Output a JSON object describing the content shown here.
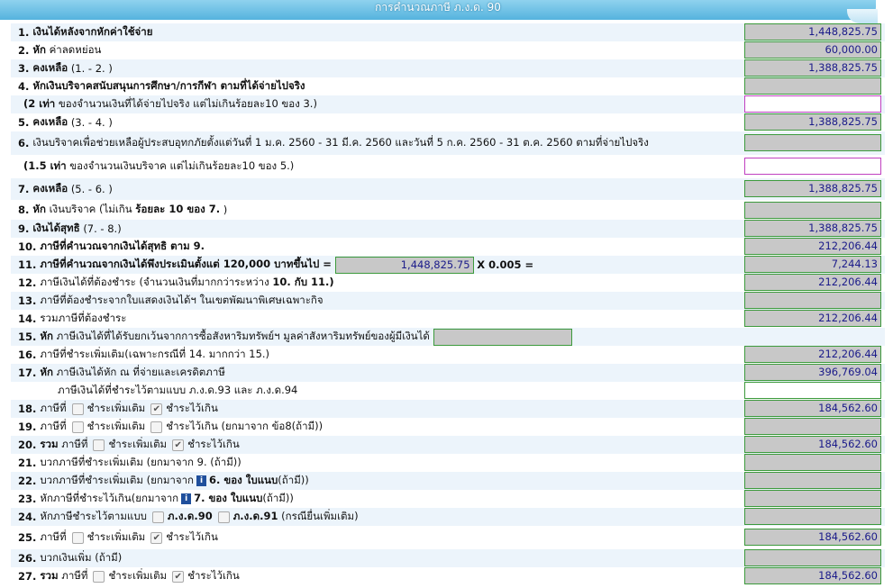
{
  "header": {
    "title": "การคำนวณภาษี ภ.ง.ด. 90"
  },
  "rows": {
    "r1": {
      "num": "1.",
      "label": "เงินได้หลังจากหักค่าใช้จ่าย",
      "value": "1,448,825.75"
    },
    "r2": {
      "num": "2.",
      "label_bold": "หัก",
      "label": "ค่าลดหย่อน",
      "value": "60,000.00"
    },
    "r3": {
      "num": "3.",
      "label_bold": "คงเหลือ",
      "label": "(1. - 2. )",
      "value": "1,388,825.75"
    },
    "r4": {
      "num": "4.",
      "label": "หักเงินบริจาคสนับสนุนการศึกษา/การกีฬา ตามที่ได้จ่ายไปจริง",
      "value": ""
    },
    "r4b": {
      "bold": "(2 เท่า",
      "label": "ของจำนวนเงินที่ได้จ่ายไปจริง แต่ไม่เกินร้อยละ10 ของ 3.)",
      "value": ""
    },
    "r5": {
      "num": "5.",
      "label_bold": "คงเหลือ",
      "label": "(3. - 4. )",
      "value": "1,388,825.75"
    },
    "r6": {
      "num": "6.",
      "label": "เงินบริจาคเพื่อช่วยเหลือผู้ประสบอุทกภัยตั้งแต่วันที่ 1 ม.ค. 2560 - 31 มี.ค. 2560 และวันที่ 5 ก.ค. 2560 - 31 ต.ค. 2560 ตามที่จ่ายไปจริง",
      "value": ""
    },
    "r6b": {
      "bold": "(1.5 เท่า",
      "label": "ของจำนวนเงินบริจาค แต่ไม่เกินร้อยละ10 ของ 5.)",
      "value": ""
    },
    "r7": {
      "num": "7.",
      "label_bold": "คงเหลือ",
      "label": "(5. - 6. )",
      "value": "1,388,825.75"
    },
    "r8": {
      "num": "8.",
      "label_bold": "หัก",
      "label": "เงินบริจาค (ไม่เกิน",
      "label_bold2": "ร้อยละ 10 ของ 7.",
      "label_end": ")",
      "value": ""
    },
    "r9": {
      "num": "9.",
      "label_bold": "เงินได้สุทธิ",
      "label": "(7. - 8.)",
      "value": "1,388,825.75"
    },
    "r10": {
      "num": "10.",
      "label": "ภาษีที่คำนวณจากเงินได้สุทธิ ตาม 9.",
      "value": "212,206.44"
    },
    "r11": {
      "num": "11.",
      "label": "ภาษีที่คำนวณจากเงินได้พึงประเมินตั้งแต่ 120,000 บาทขึ้นไป =",
      "inline_value": "1,448,825.75",
      "multiplier": "X 0.005 =",
      "value": "7,244.13"
    },
    "r12": {
      "num": "12.",
      "label": "ภาษีเงินได้ที่ต้องชำระ (จำนวนเงินที่มากกว่าระหว่าง",
      "label_bold": "10. กับ 11.)",
      "value": "212,206.44"
    },
    "r13": {
      "num": "13.",
      "label": "ภาษีที่ต้องชำระจากใบแสดงเงินได้ฯ ในเขตพัฒนาพิเศษเฉพาะกิจ",
      "value": ""
    },
    "r14": {
      "num": "14.",
      "label": "รวมภาษีที่ต้องชำระ",
      "value": "212,206.44"
    },
    "r15": {
      "num": "15.",
      "label_bold": "หัก",
      "label": "ภาษีเงินได้ที่ได้รับยกเว้นจากการซื้อสังหาริมทรัพย์ฯ มูลค่าสังหาริมทรัพย์ของผู้มีเงินได้",
      "inline_value": "",
      "value": ""
    },
    "r16": {
      "num": "16.",
      "label": "ภาษีที่ชำระเพิ่มเติม(เฉพาะกรณีที่ 14. มากกว่า 15.)",
      "value": "212,206.44"
    },
    "r17": {
      "num": "17.",
      "label_bold": "หัก",
      "label": "ภาษีเงินได้หัก ณ ที่จ่ายและเครดิตภาษี",
      "value": "396,769.04"
    },
    "r17b": {
      "label": "ภาษีเงินได้ที่ชำระไว้ตามแบบ ภ.ง.ด.93 และ ภ.ง.ด.94",
      "value": ""
    },
    "r18": {
      "num": "18.",
      "label": "ภาษีที่",
      "opt1": "ชำระเพิ่มเติม",
      "opt2": "ชำระไว้เกิน",
      "value": "184,562.60"
    },
    "r19": {
      "num": "19.",
      "label": "ภาษีที่",
      "opt1": "ชำระเพิ่มเติม",
      "opt2": "ชำระไว้เกิน (ยกมาจาก ข้อ8(ถ้ามี))",
      "value": ""
    },
    "r20": {
      "num": "20.",
      "label_bold": "รวม",
      "label": "ภาษีที่",
      "opt1": "ชำระเพิ่มเติม",
      "opt2": "ชำระไว้เกิน",
      "value": "184,562.60"
    },
    "r21": {
      "num": "21.",
      "label": "บวกภาษีที่ชำระเพิ่มเติม (ยกมาจาก 9. (ถ้ามี))",
      "value": ""
    },
    "r22": {
      "num": "22.",
      "label": "บวกภาษีที่ชำระเพิ่มเติม (ยกมาจาก",
      "ref": "6. ของ ใบแนบ",
      "end": "(ถ้ามี))",
      "value": ""
    },
    "r23": {
      "num": "23.",
      "label": "หักภาษีที่ชำระไว้เกิน(ยกมาจาก",
      "ref": "7. ของ ใบแนบ",
      "end": "(ถ้ามี))",
      "value": ""
    },
    "r24": {
      "num": "24.",
      "label": "หักภาษีชำระไว้ตามแบบ",
      "opt1": "ภ.ง.ด.90",
      "opt2": "ภ.ง.ด.91",
      "end": "(กรณียื่นเพิ่มเติม)",
      "value": ""
    },
    "r25": {
      "num": "25.",
      "label": "ภาษีที่",
      "opt1": "ชำระเพิ่มเติม",
      "opt2": "ชำระไว้เกิน",
      "value": "184,562.60"
    },
    "r26": {
      "num": "26.",
      "label": "บวกเงินเพิ่ม (ถ้ามี)",
      "value": ""
    },
    "r27": {
      "num": "27.",
      "label_bold": "รวม",
      "label": "ภาษีที่",
      "opt1": "ชำระเพิ่มเติม",
      "opt2": "ชำระไว้เกิน",
      "value": "184,562.60"
    }
  },
  "checkbox_states": {
    "r18": {
      "opt1": false,
      "opt2": true
    },
    "r19": {
      "opt1": false,
      "opt2": false
    },
    "r20": {
      "opt1": false,
      "opt2": true
    },
    "r24": {
      "opt1": false,
      "opt2": false
    },
    "r25": {
      "opt1": false,
      "opt2": true
    },
    "r27": {
      "opt1": false,
      "opt2": true
    }
  },
  "colors": {
    "header": "#55b3de",
    "field_bg": "#c8c8c8",
    "field_border": "#3c9a3c",
    "value_text": "#1b1b8a",
    "purple_border": "#c040c0"
  }
}
